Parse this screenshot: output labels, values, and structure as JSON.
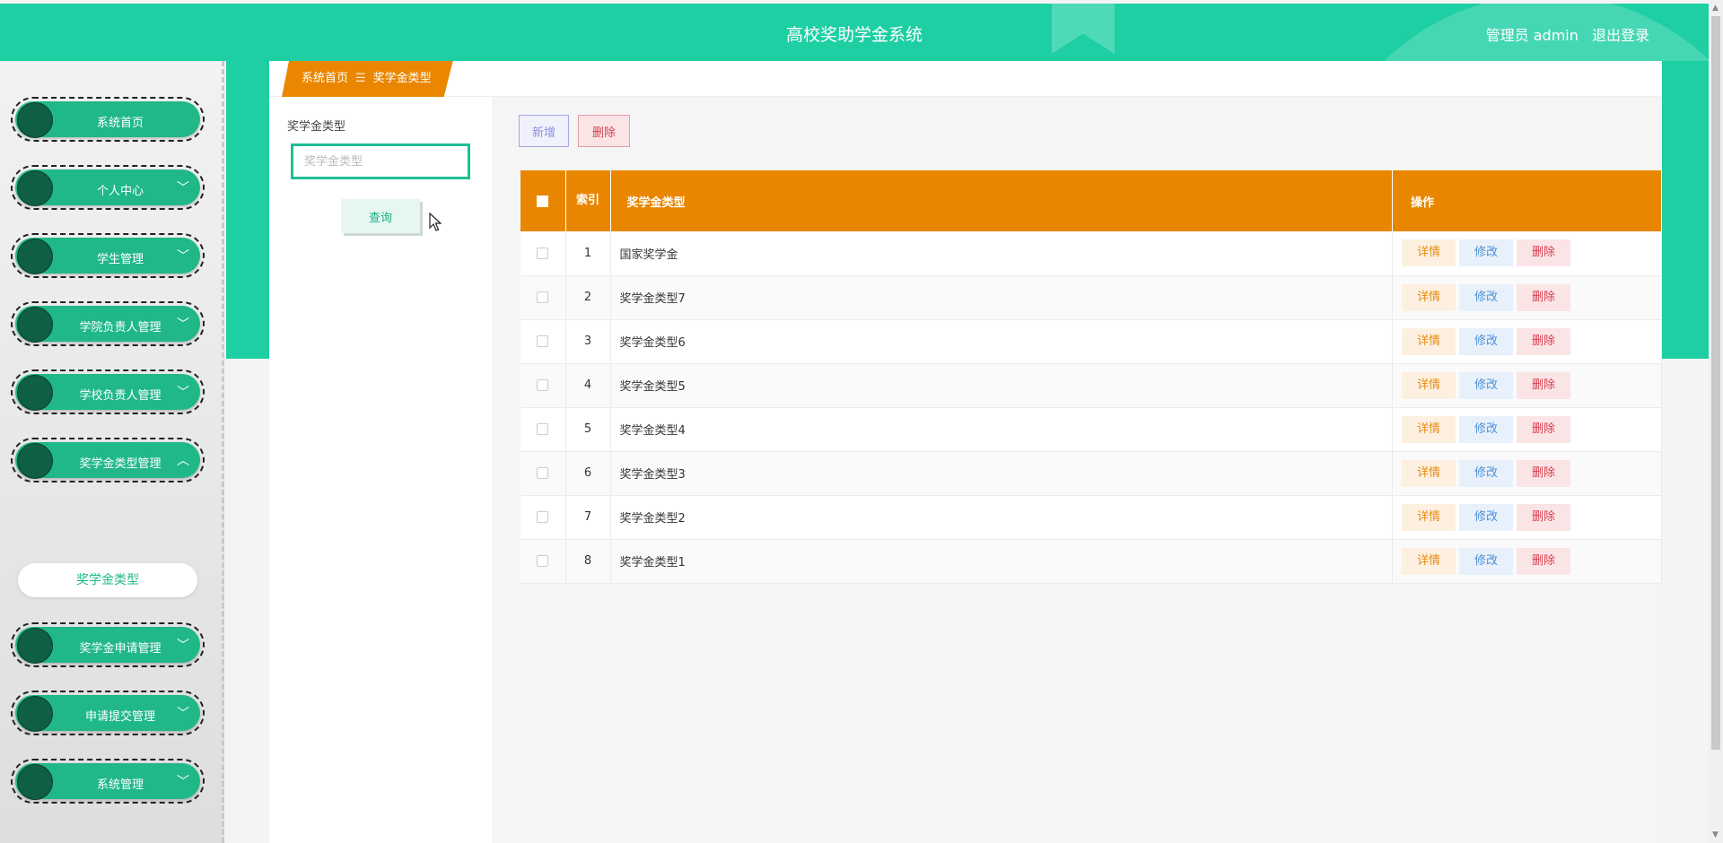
{
  "header": {
    "title": "高校奖助学金系统",
    "user_text": "管理员 admin",
    "logout": "退出登录"
  },
  "sidebar": {
    "items": [
      {
        "label": "系统首页",
        "chevron": ""
      },
      {
        "label": "个人中心",
        "chevron": "﹀"
      },
      {
        "label": "学生管理",
        "chevron": "﹀"
      },
      {
        "label": "学院负责人管理",
        "chevron": "﹀"
      },
      {
        "label": "学校负责人管理",
        "chevron": "﹀"
      },
      {
        "label": "奖学金类型管理",
        "chevron": "︿"
      },
      {
        "label": "奖学金申请管理",
        "chevron": "﹀"
      },
      {
        "label": "申请提交管理",
        "chevron": "﹀"
      },
      {
        "label": "系统管理",
        "chevron": "﹀"
      }
    ],
    "submenu": {
      "label": "奖学金类型"
    }
  },
  "breadcrumb": {
    "home": "系统首页",
    "sep": "☰",
    "current": "奖学金类型"
  },
  "search": {
    "label": "奖学金类型",
    "placeholder": "奖学金类型",
    "button": "查询"
  },
  "toolbar": {
    "add": "新增",
    "delete": "删除"
  },
  "table": {
    "headers": {
      "index": "索引",
      "name": "奖学金类型",
      "ops": "操作"
    },
    "ops": {
      "detail": "详情",
      "edit": "修改",
      "delete": "删除"
    },
    "rows": [
      {
        "index": "1",
        "name": "国家奖学金"
      },
      {
        "index": "2",
        "name": "奖学金类型7"
      },
      {
        "index": "3",
        "name": "奖学金类型6"
      },
      {
        "index": "4",
        "name": "奖学金类型5"
      },
      {
        "index": "5",
        "name": "奖学金类型4"
      },
      {
        "index": "6",
        "name": "奖学金类型3"
      },
      {
        "index": "7",
        "name": "奖学金类型2"
      },
      {
        "index": "8",
        "name": "奖学金类型1"
      }
    ]
  },
  "colors": {
    "brand_teal": "#1dcfa3",
    "sidebar_green": "#21b889",
    "table_orange": "#e88600"
  }
}
